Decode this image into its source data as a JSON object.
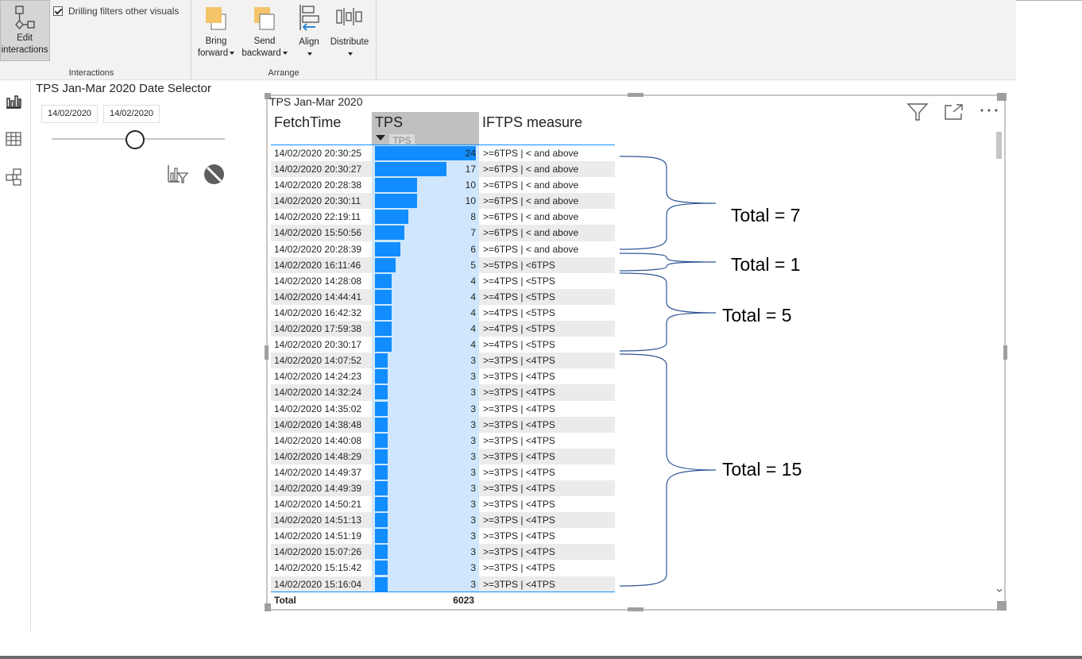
{
  "ribbon": {
    "edit_interactions_label": "Edit interactions",
    "drilling_filters_label": "Drilling filters other visuals",
    "interactions_group": "Interactions",
    "bring_forward_line1": "Bring",
    "bring_forward_line2": "forward",
    "send_backward_line1": "Send",
    "send_backward_line2": "backward",
    "align_label": "Align",
    "distribute_label": "Distribute",
    "arrange_group": "Arrange"
  },
  "slicer": {
    "title": "TPS Jan-Mar 2020 Date Selector",
    "start_date": "14/02/2020",
    "end_date": "14/02/2020",
    "slider_position": 0.43
  },
  "visual": {
    "title": "TPS Jan-Mar 2020",
    "columns": [
      "FetchTime",
      "TPS",
      "IFTPS measure"
    ],
    "tooltip": "TPS",
    "total_label": "Total",
    "total_value": "6023",
    "bar_max": 24,
    "rows": [
      {
        "fetch": "14/02/2020 20:30:25",
        "tps": 24,
        "iftps": ">=6TPS | < and above"
      },
      {
        "fetch": "14/02/2020 20:30:27",
        "tps": 17,
        "iftps": ">=6TPS | < and above"
      },
      {
        "fetch": "14/02/2020 20:28:38",
        "tps": 10,
        "iftps": ">=6TPS | < and above"
      },
      {
        "fetch": "14/02/2020 20:30:11",
        "tps": 10,
        "iftps": ">=6TPS | < and above"
      },
      {
        "fetch": "14/02/2020 22:19:11",
        "tps": 8,
        "iftps": ">=6TPS | < and above"
      },
      {
        "fetch": "14/02/2020 15:50:56",
        "tps": 7,
        "iftps": ">=6TPS | < and above"
      },
      {
        "fetch": "14/02/2020 20:28:39",
        "tps": 6,
        "iftps": ">=6TPS | < and above"
      },
      {
        "fetch": "14/02/2020 16:11:46",
        "tps": 5,
        "iftps": ">=5TPS | <6TPS"
      },
      {
        "fetch": "14/02/2020 14:28:08",
        "tps": 4,
        "iftps": ">=4TPS | <5TPS"
      },
      {
        "fetch": "14/02/2020 14:44:41",
        "tps": 4,
        "iftps": ">=4TPS | <5TPS"
      },
      {
        "fetch": "14/02/2020 16:42:32",
        "tps": 4,
        "iftps": ">=4TPS | <5TPS"
      },
      {
        "fetch": "14/02/2020 17:59:38",
        "tps": 4,
        "iftps": ">=4TPS | <5TPS"
      },
      {
        "fetch": "14/02/2020 20:30:17",
        "tps": 4,
        "iftps": ">=4TPS | <5TPS"
      },
      {
        "fetch": "14/02/2020 14:07:52",
        "tps": 3,
        "iftps": ">=3TPS | <4TPS"
      },
      {
        "fetch": "14/02/2020 14:24:23",
        "tps": 3,
        "iftps": ">=3TPS | <4TPS"
      },
      {
        "fetch": "14/02/2020 14:32:24",
        "tps": 3,
        "iftps": ">=3TPS | <4TPS"
      },
      {
        "fetch": "14/02/2020 14:35:02",
        "tps": 3,
        "iftps": ">=3TPS | <4TPS"
      },
      {
        "fetch": "14/02/2020 14:38:48",
        "tps": 3,
        "iftps": ">=3TPS | <4TPS"
      },
      {
        "fetch": "14/02/2020 14:40:08",
        "tps": 3,
        "iftps": ">=3TPS | <4TPS"
      },
      {
        "fetch": "14/02/2020 14:48:29",
        "tps": 3,
        "iftps": ">=3TPS | <4TPS"
      },
      {
        "fetch": "14/02/2020 14:49:37",
        "tps": 3,
        "iftps": ">=3TPS | <4TPS"
      },
      {
        "fetch": "14/02/2020 14:49:39",
        "tps": 3,
        "iftps": ">=3TPS | <4TPS"
      },
      {
        "fetch": "14/02/2020 14:50:21",
        "tps": 3,
        "iftps": ">=3TPS | <4TPS"
      },
      {
        "fetch": "14/02/2020 14:51:13",
        "tps": 3,
        "iftps": ">=3TPS | <4TPS"
      },
      {
        "fetch": "14/02/2020 14:51:19",
        "tps": 3,
        "iftps": ">=3TPS | <4TPS"
      },
      {
        "fetch": "14/02/2020 15:07:26",
        "tps": 3,
        "iftps": ">=3TPS | <4TPS"
      },
      {
        "fetch": "14/02/2020 15:15:42",
        "tps": 3,
        "iftps": ">=3TPS | <4TPS"
      },
      {
        "fetch": "14/02/2020 15:16:04",
        "tps": 3,
        "iftps": ">=3TPS | <4TPS"
      }
    ]
  },
  "annotations": [
    "Total = 7",
    "Total = 1",
    "Total = 5",
    "Total = 15"
  ],
  "icons": {
    "edit_interactions": "edit-interactions-icon",
    "bring_forward": "bring-forward-icon",
    "send_backward": "send-backward-icon",
    "align": "align-icon",
    "distribute": "distribute-icon",
    "report_view": "report-view-icon",
    "data_view": "data-view-icon",
    "model_view": "model-view-icon",
    "filter": "filter-icon",
    "focus_mode": "focus-mode-icon",
    "more_options": "more-options-icon"
  },
  "colors": {
    "bar": "#118dff",
    "bar_background": "#cfe6fc",
    "header_selected": "#c0c0c0",
    "annotation_bracket": "#2f5597"
  }
}
